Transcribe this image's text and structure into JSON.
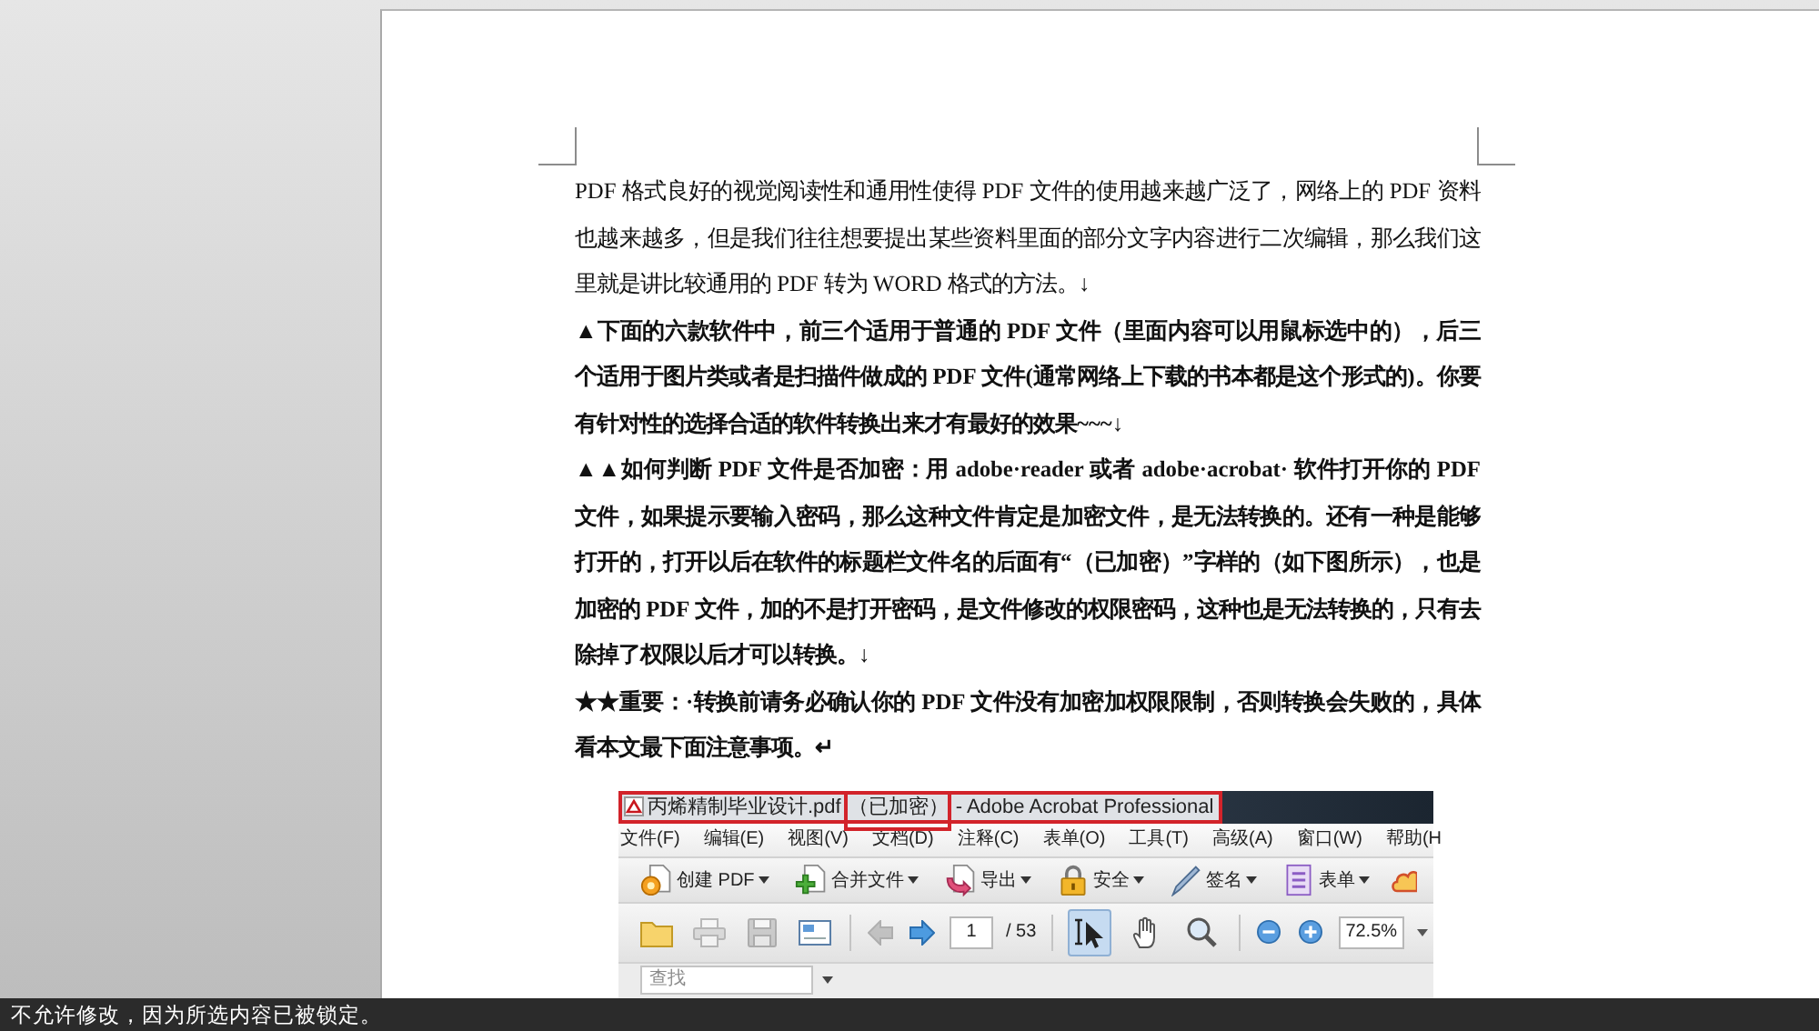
{
  "document": {
    "paragraphs": [
      {
        "text": "PDF 格式良好的视觉阅读性和通用性使得 PDF 文件的使用越来越广泛了，网络上的 PDF 资料也越来越多，但是我们往往想要提出某些资料里面的部分文字内容进行二次编辑，那么我们这里就是讲比较通用的 PDF 转为 WORD 格式的方法。↓",
        "bold": false
      },
      {
        "text": "▲下面的六款软件中，前三个适用于普通的 PDF 文件（里面内容可以用鼠标选中的），后三个适用于图片类或者是扫描件做成的 PDF 文件(通常网络上下载的书本都是这个形式的)。你要有针对性的选择合适的软件转换出来才有最好的效果~~~↓",
        "bold": true
      },
      {
        "text": "▲▲如何判断 PDF 文件是否加密：用 adobe·reader 或者 adobe·acrobat· 软件打开你的 PDF 文件，如果提示要输入密码，那么这种文件肯定是加密文件，是无法转换的。还有一种是能够打开的，打开以后在软件的标题栏文件名的后面有“（已加密）”字样的（如下图所示），也是加密的 PDF 文件，加的不是打开密码，是文件修改的权限密码，这种也是无法转换的，只有去除掉了权限以后才可以转换。↓",
        "bold": true
      },
      {
        "text": "★★重要：·转换前请务必确认你的 PDF 文件没有加密加权限限制，否则转换会失败的，具体看本文最下面注意事项。↵",
        "bold": true
      }
    ]
  },
  "figure": {
    "title_bar": {
      "highlighted": true,
      "parts": [
        {
          "text": "丙烯精制毕业设计.pdf",
          "highlighted": false
        },
        {
          "text": "（已加密）",
          "highlighted": true
        },
        {
          "text": "- Adobe Acrobat Professional",
          "highlighted": false
        }
      ]
    },
    "menu": [
      "文件(F)",
      "编辑(E)",
      "视图(V)",
      "文档(D)",
      "注释(C)",
      "表单(O)",
      "工具(T)",
      "高级(A)",
      "窗口(W)",
      "帮助(H"
    ],
    "task_toolbar": [
      {
        "label": "创建 PDF"
      },
      {
        "label": "合并文件"
      },
      {
        "label": "导出"
      },
      {
        "label": "安全"
      },
      {
        "label": "签名"
      },
      {
        "label": "表单"
      }
    ],
    "nav_toolbar": {
      "file_buttons": [
        {
          "disabled": false
        },
        {
          "disabled": true
        },
        {
          "disabled": true
        },
        {
          "disabled": false
        }
      ],
      "page_buttons": [
        {
          "disabled": true
        },
        {
          "disabled": false
        }
      ],
      "page_field": {
        "value": "1"
      },
      "page_count": "/ 53",
      "tools": [
        {
          "selected": true
        },
        {
          "selected": false
        },
        {
          "selected": false
        }
      ],
      "zoom_buttons": [
        {
          "disabled": false
        },
        {
          "disabled": false
        }
      ],
      "zoom_field": {
        "value": "72.5%"
      }
    },
    "find_bar": {
      "placeholder": "查找"
    }
  },
  "status_bar": {
    "text": "不允许修改，因为所选内容已被锁定。"
  }
}
